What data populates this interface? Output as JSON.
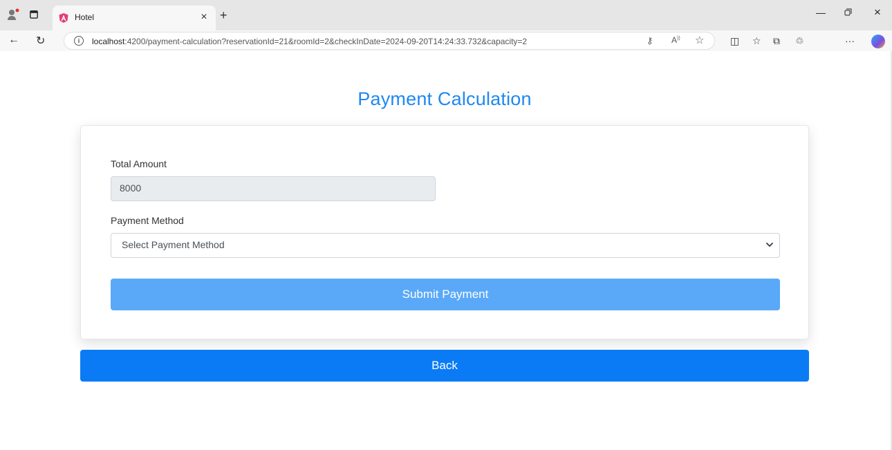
{
  "browser": {
    "tab_title": "Hotel",
    "url_host": "localhost",
    "url_rest": ":4200/payment-calculation?reservationId=21&roomId=2&checkInDate=2024-09-20T14:24:33.732&capacity=2",
    "icons": {
      "profile": "profile-icon",
      "tabs": "tab-actions-icon",
      "favicon": "angular-favicon",
      "close_tab": "close-icon",
      "new_tab": "plus-icon",
      "back": "back-arrow-icon",
      "refresh": "refresh-icon",
      "info": "site-info-icon",
      "read_aloud": "read-aloud-icon",
      "favorite": "star-icon",
      "split": "split-screen-icon",
      "favorites": "favorites-icon",
      "collections": "collections-icon",
      "extensions": "extensions-icon",
      "more": "more-icon",
      "copilot": "copilot-icon"
    }
  },
  "page": {
    "title": "Payment Calculation",
    "total_amount_label": "Total Amount",
    "total_amount_value": "8000",
    "payment_method_label": "Payment Method",
    "payment_method_selected": "Select Payment Method",
    "submit_label": "Submit Payment",
    "back_label": "Back"
  },
  "colors": {
    "title": "#1e88f0",
    "submit_button": "#5aa9f8",
    "back_button": "#0b7bf5",
    "readonly_field": "#e9ecef"
  }
}
